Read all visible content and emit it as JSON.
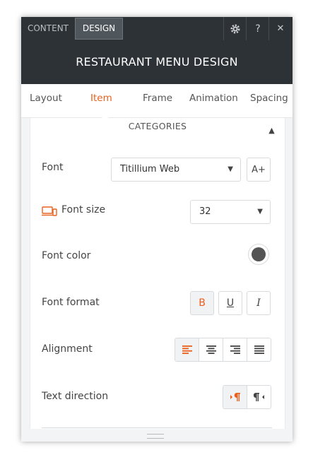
{
  "topbar": {
    "tab_content": "CONTENT",
    "tab_design": "DESIGN",
    "help_label": "?",
    "close_label": "✕"
  },
  "header": {
    "title": "RESTAURANT MENU DESIGN"
  },
  "subtabs": [
    "Layout",
    "Item",
    "Frame",
    "Animation",
    "Spacing"
  ],
  "active_subtab": "Item",
  "section": {
    "title": "CATEGORIES"
  },
  "font": {
    "label": "Font",
    "value": "Titillium Web",
    "add_label": "A+"
  },
  "font_size": {
    "label": "Font size",
    "value": "32"
  },
  "font_color": {
    "label": "Font color",
    "value": "#555555"
  },
  "font_format": {
    "label": "Font format",
    "bold": "B",
    "underline": "U",
    "italic": "I"
  },
  "alignment": {
    "label": "Alignment"
  },
  "text_direction": {
    "label": "Text direction"
  },
  "colors": {
    "accent": "#e8601c",
    "dark": "#2d3236"
  }
}
